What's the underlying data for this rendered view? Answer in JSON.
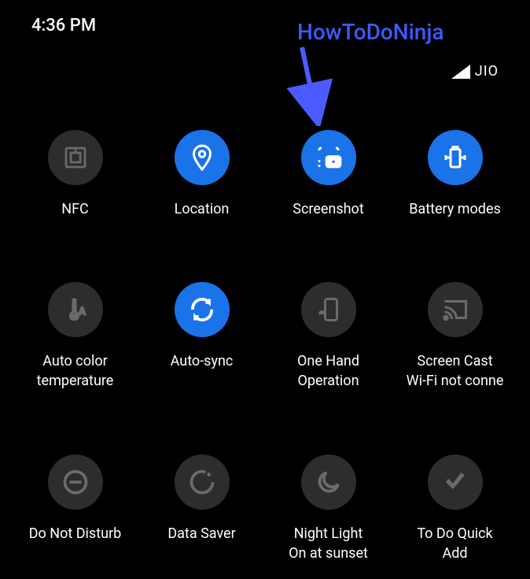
{
  "status_bar": {
    "time": "4:36 PM",
    "carrier": "JIO"
  },
  "annotation": {
    "text": "HowToDoNinja"
  },
  "tiles": [
    {
      "label": "NFC",
      "active": false
    },
    {
      "label": "Location",
      "active": true
    },
    {
      "label": "Screenshot",
      "active": true
    },
    {
      "label": "Battery modes",
      "active": true
    },
    {
      "label": "Auto color\ntemperature",
      "active": false
    },
    {
      "label": "Auto-sync",
      "active": true
    },
    {
      "label": "One Hand\nOperation",
      "active": false
    },
    {
      "label": "Screen Cast\nWi-Fi not conne",
      "active": false
    },
    {
      "label": "Do Not Disturb",
      "active": false
    },
    {
      "label": "Data Saver",
      "active": false
    },
    {
      "label": "Night Light\nOn at sunset",
      "active": false
    },
    {
      "label": "To Do Quick\nAdd",
      "active": false
    }
  ]
}
